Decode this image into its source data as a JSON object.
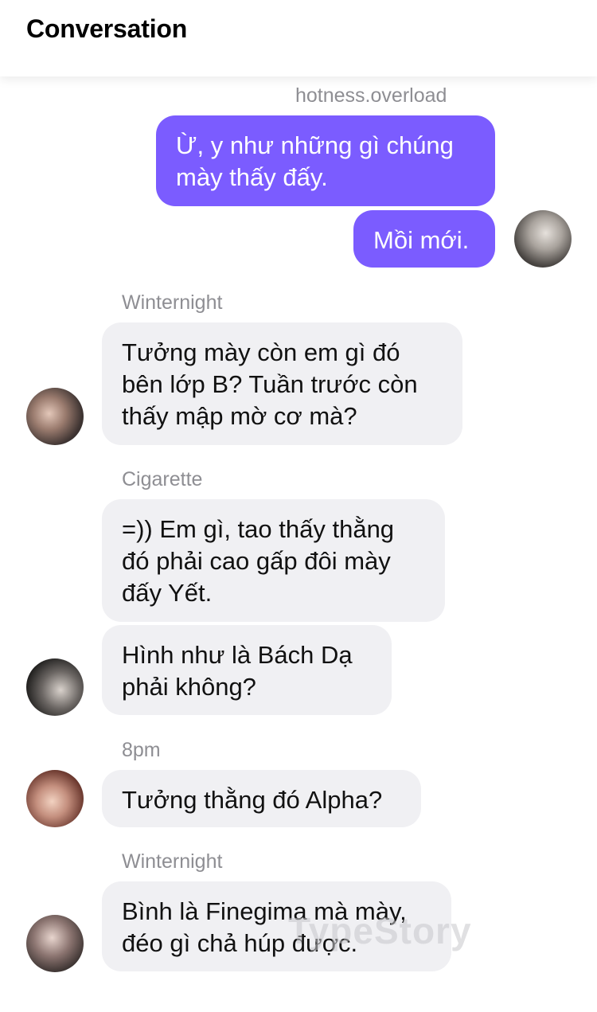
{
  "header": {
    "title": "Conversation"
  },
  "messages": [
    {
      "sender": "hotness.overload",
      "direction": "out",
      "text": "Ừ, y như những gì chúng\nmày thấy đấy."
    },
    {
      "direction": "out",
      "text": "Mồi mới."
    },
    {
      "sender": "Winternight",
      "direction": "in",
      "text": "Tưởng mày còn em gì đó\nbên lớp B? Tuần trước còn\nthấy mập mờ cơ mà?"
    },
    {
      "sender": "Cigarette",
      "direction": "in",
      "text": "=)) Em gì, tao thấy thằng\nđó phải cao gấp đôi mày\nđấy Yết."
    },
    {
      "direction": "in",
      "text": "Hình như là Bách Dạ\nphải không?"
    },
    {
      "sender": "8pm",
      "direction": "in",
      "text": "Tưởng thằng đó Alpha?"
    },
    {
      "sender": "Winternight",
      "direction": "in",
      "text": "Bình là Finegima mà mày,\nđéo gì chả húp được."
    }
  ],
  "watermark": "TypeStory",
  "colors": {
    "outgoing_bubble": "#7b5cff",
    "incoming_bubble": "#f0f0f3",
    "sender_name": "#8e8e93"
  }
}
